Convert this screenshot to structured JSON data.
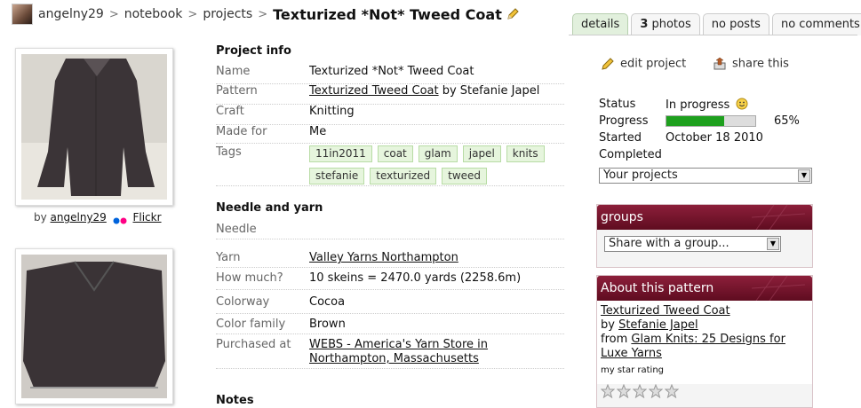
{
  "breadcrumb": {
    "user": "angelny29",
    "sep": ">",
    "notebook": "notebook",
    "projects": "projects",
    "title": "Texturized *Not* Tweed Coat"
  },
  "tabs": {
    "details": "details",
    "photos_count": "3",
    "photos_label": " photos",
    "posts": "no posts",
    "comments": "no comments"
  },
  "photo_credit": {
    "by": "by",
    "user": "angelny29",
    "source": "Flickr"
  },
  "project_info": {
    "heading": "Project info",
    "name_label": "Name",
    "name": "Texturized *Not* Tweed Coat",
    "pattern_label": "Pattern",
    "pattern": "Texturized Tweed Coat",
    "pattern_by": " by Stefanie Japel",
    "craft_label": "Craft",
    "craft": "Knitting",
    "made_for_label": "Made for",
    "made_for": "Me",
    "tags_label": "Tags",
    "tags": [
      "11in2011",
      "coat",
      "glam",
      "japel",
      "knits",
      "stefanie",
      "texturized",
      "tweed"
    ]
  },
  "needle_yarn": {
    "heading": "Needle and yarn",
    "needle_label": "Needle",
    "yarn_label": "Yarn",
    "yarn": "Valley Yarns Northampton",
    "how_much_label": "How much?",
    "how_much": "10 skeins = 2470.0 yards (2258.6m)",
    "colorway_label": "Colorway",
    "colorway": "Cocoa",
    "color_family_label": "Color family",
    "color_family": "Brown",
    "purchased_label": "Purchased at",
    "purchased_line1": "WEBS - America's Yarn Store in",
    "purchased_line2": "Northampton, Massachusetts"
  },
  "notes_heading": "Notes",
  "actions": {
    "edit": "edit project",
    "share": "share this"
  },
  "status": {
    "status_label": "Status",
    "status": "In progress",
    "progress_label": "Progress",
    "progress_text": "65%",
    "progress_value": 65,
    "started_label": "Started",
    "started": "October 18 2010",
    "completed_label": "Completed",
    "projects_select": "Your projects"
  },
  "groups": {
    "heading": "groups",
    "select": "Share with a group..."
  },
  "about": {
    "heading": "About this pattern",
    "pattern": "Texturized Tweed Coat",
    "by": "by ",
    "designer": "Stefanie Japel",
    "from": "from ",
    "book": "Glam Knits: 25 Designs for Luxe Yarns",
    "rating_label": "my star rating"
  },
  "colors": {
    "tab_active": "#e2f0dd",
    "tag_bg": "#e6f5dd",
    "progress_fill": "#1ea01e",
    "box_header": "#7a1530"
  }
}
